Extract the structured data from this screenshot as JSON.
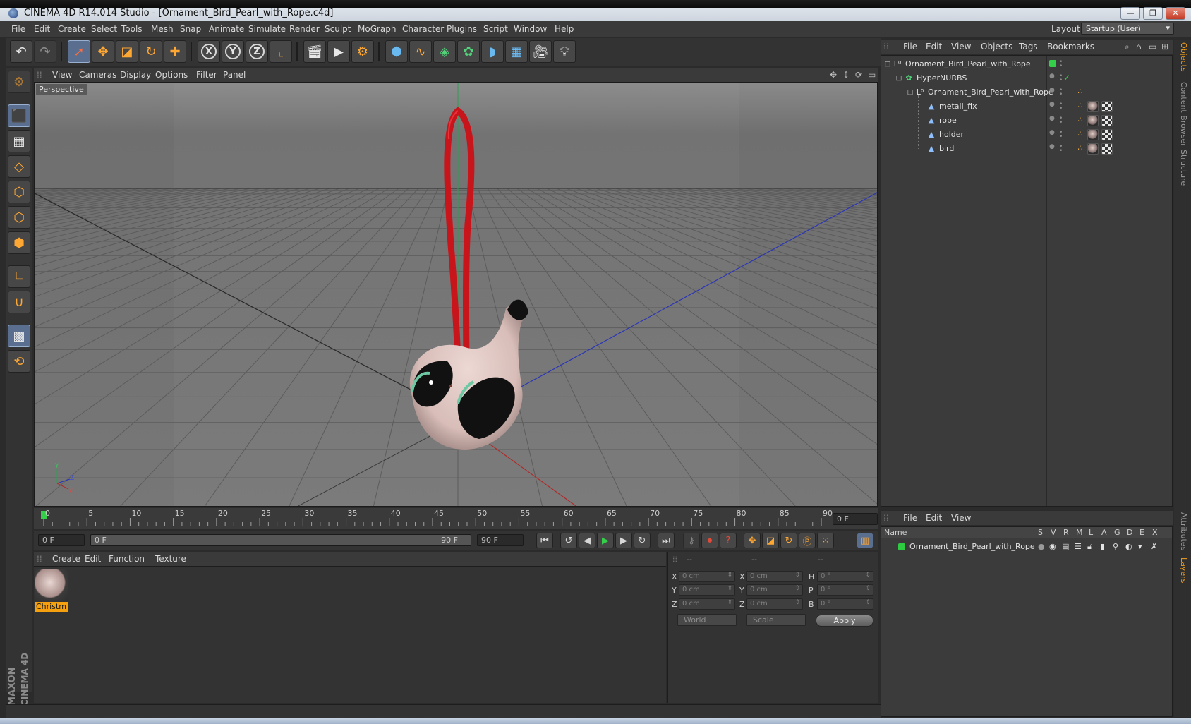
{
  "window": {
    "title": "CINEMA 4D R14.014 Studio - [Ornament_Bird_Pearl_with_Rope.c4d]",
    "controls": [
      "—",
      "❐",
      "✕"
    ]
  },
  "menu": {
    "items": [
      "File",
      "Edit",
      "Create",
      "Select",
      "Tools",
      "Mesh",
      "Snap",
      "Animate",
      "Simulate",
      "Render",
      "Sculpt",
      "MoGraph",
      "Character",
      "Plugins",
      "Script",
      "Window",
      "Help"
    ],
    "layout_label": "Layout:",
    "layout_value": "Startup (User)"
  },
  "toolbar": {
    "axes": [
      "X",
      "Y",
      "Z"
    ]
  },
  "viewport": {
    "menu": [
      "View",
      "Cameras",
      "Display",
      "Options",
      "Filter",
      "Panel"
    ],
    "label": "Perspective",
    "colors": {
      "bg": "#777777",
      "grid": "#5f5f5f",
      "red_rope": "#c8151b",
      "x_axis": "#c02020",
      "y_axis": "#20a040",
      "z_axis": "#2030c0"
    }
  },
  "timeline": {
    "ticks": [
      "0",
      "5",
      "10",
      "15",
      "20",
      "25",
      "30",
      "35",
      "40",
      "45",
      "50",
      "55",
      "60",
      "65",
      "70",
      "75",
      "80",
      "85",
      "90"
    ],
    "current_frame": "0 F",
    "start_frame": "0 F",
    "range_start": "0 F",
    "range_end": "90 F",
    "end_frame": "90 F"
  },
  "materials": {
    "menu": [
      "Create",
      "Edit",
      "Function",
      "Texture"
    ],
    "items": [
      {
        "label": "Christm"
      }
    ]
  },
  "coordinates": {
    "headers": [
      "--",
      "--",
      "--"
    ],
    "rows": [
      {
        "l1": "X",
        "v1": "0 cm",
        "l2": "X",
        "v2": "0 cm",
        "l3": "H",
        "v3": "0 °"
      },
      {
        "l1": "Y",
        "v1": "0 cm",
        "l2": "Y",
        "v2": "0 cm",
        "l3": "P",
        "v3": "0 °"
      },
      {
        "l1": "Z",
        "v1": "0 cm",
        "l2": "Z",
        "v2": "0 cm",
        "l3": "B",
        "v3": "0 °"
      }
    ],
    "mode": "World",
    "type": "Scale",
    "apply": "Apply"
  },
  "objects": {
    "menu": [
      "File",
      "Edit",
      "View",
      "Objects",
      "Tags",
      "Bookmarks"
    ],
    "tree": [
      {
        "name": "Ornament_Bird_Pearl_with_Rope",
        "level": 0,
        "icon": "null-icon",
        "tags": []
      },
      {
        "name": "HyperNURBS",
        "level": 1,
        "icon": "hypernurbs-icon",
        "tags": []
      },
      {
        "name": "Ornament_Bird_Pearl_with_Rope",
        "level": 2,
        "icon": "null-icon",
        "tags": [
          "phong"
        ]
      },
      {
        "name": "metall_fix",
        "level": 3,
        "icon": "polygon-icon",
        "tags": [
          "phong",
          "texture",
          "uvw"
        ]
      },
      {
        "name": "rope",
        "level": 3,
        "icon": "polygon-icon",
        "tags": [
          "phong",
          "texture",
          "uvw"
        ]
      },
      {
        "name": "holder",
        "level": 3,
        "icon": "polygon-icon",
        "tags": [
          "phong",
          "texture",
          "uvw"
        ]
      },
      {
        "name": "bird",
        "level": 3,
        "icon": "polygon-icon",
        "tags": [
          "phong",
          "texture",
          "uvw"
        ]
      }
    ]
  },
  "layers": {
    "menu": [
      "File",
      "Edit",
      "View"
    ],
    "columns": [
      "Name",
      "S",
      "V",
      "R",
      "M",
      "L",
      "A",
      "G",
      "D",
      "E",
      "X"
    ],
    "rows": [
      {
        "name": "Ornament_Bird_Pearl_with_Rope",
        "color": "#2ecc40"
      }
    ]
  },
  "side_tabs": [
    "Objects",
    "Content Browser",
    "Structure",
    "Attributes",
    "Layers"
  ],
  "brand": {
    "maker": "MAXON",
    "product": "CINEMA 4D"
  }
}
